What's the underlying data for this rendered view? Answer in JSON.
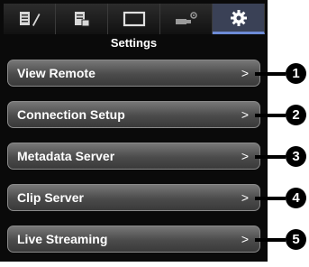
{
  "header": {
    "title": "Settings",
    "tabs": [
      {
        "icon": "edit-list-icon",
        "active": false
      },
      {
        "icon": "clip-list-icon",
        "active": false
      },
      {
        "icon": "monitor-icon",
        "active": false
      },
      {
        "icon": "camera-settings-icon",
        "active": false
      },
      {
        "icon": "gear-icon",
        "active": true
      }
    ]
  },
  "menu": {
    "items": [
      {
        "label": "View Remote",
        "chevron": ">",
        "callout": "1"
      },
      {
        "label": "Connection Setup",
        "chevron": ">",
        "callout": "2"
      },
      {
        "label": "Metadata Server",
        "chevron": ">",
        "callout": "3"
      },
      {
        "label": "Clip Server",
        "chevron": ">",
        "callout": "4"
      },
      {
        "label": "Live Streaming",
        "chevron": ">",
        "callout": "5"
      }
    ]
  },
  "colors": {
    "accent": "#6d8bd6",
    "screen_bg": "#0a0a0a"
  }
}
